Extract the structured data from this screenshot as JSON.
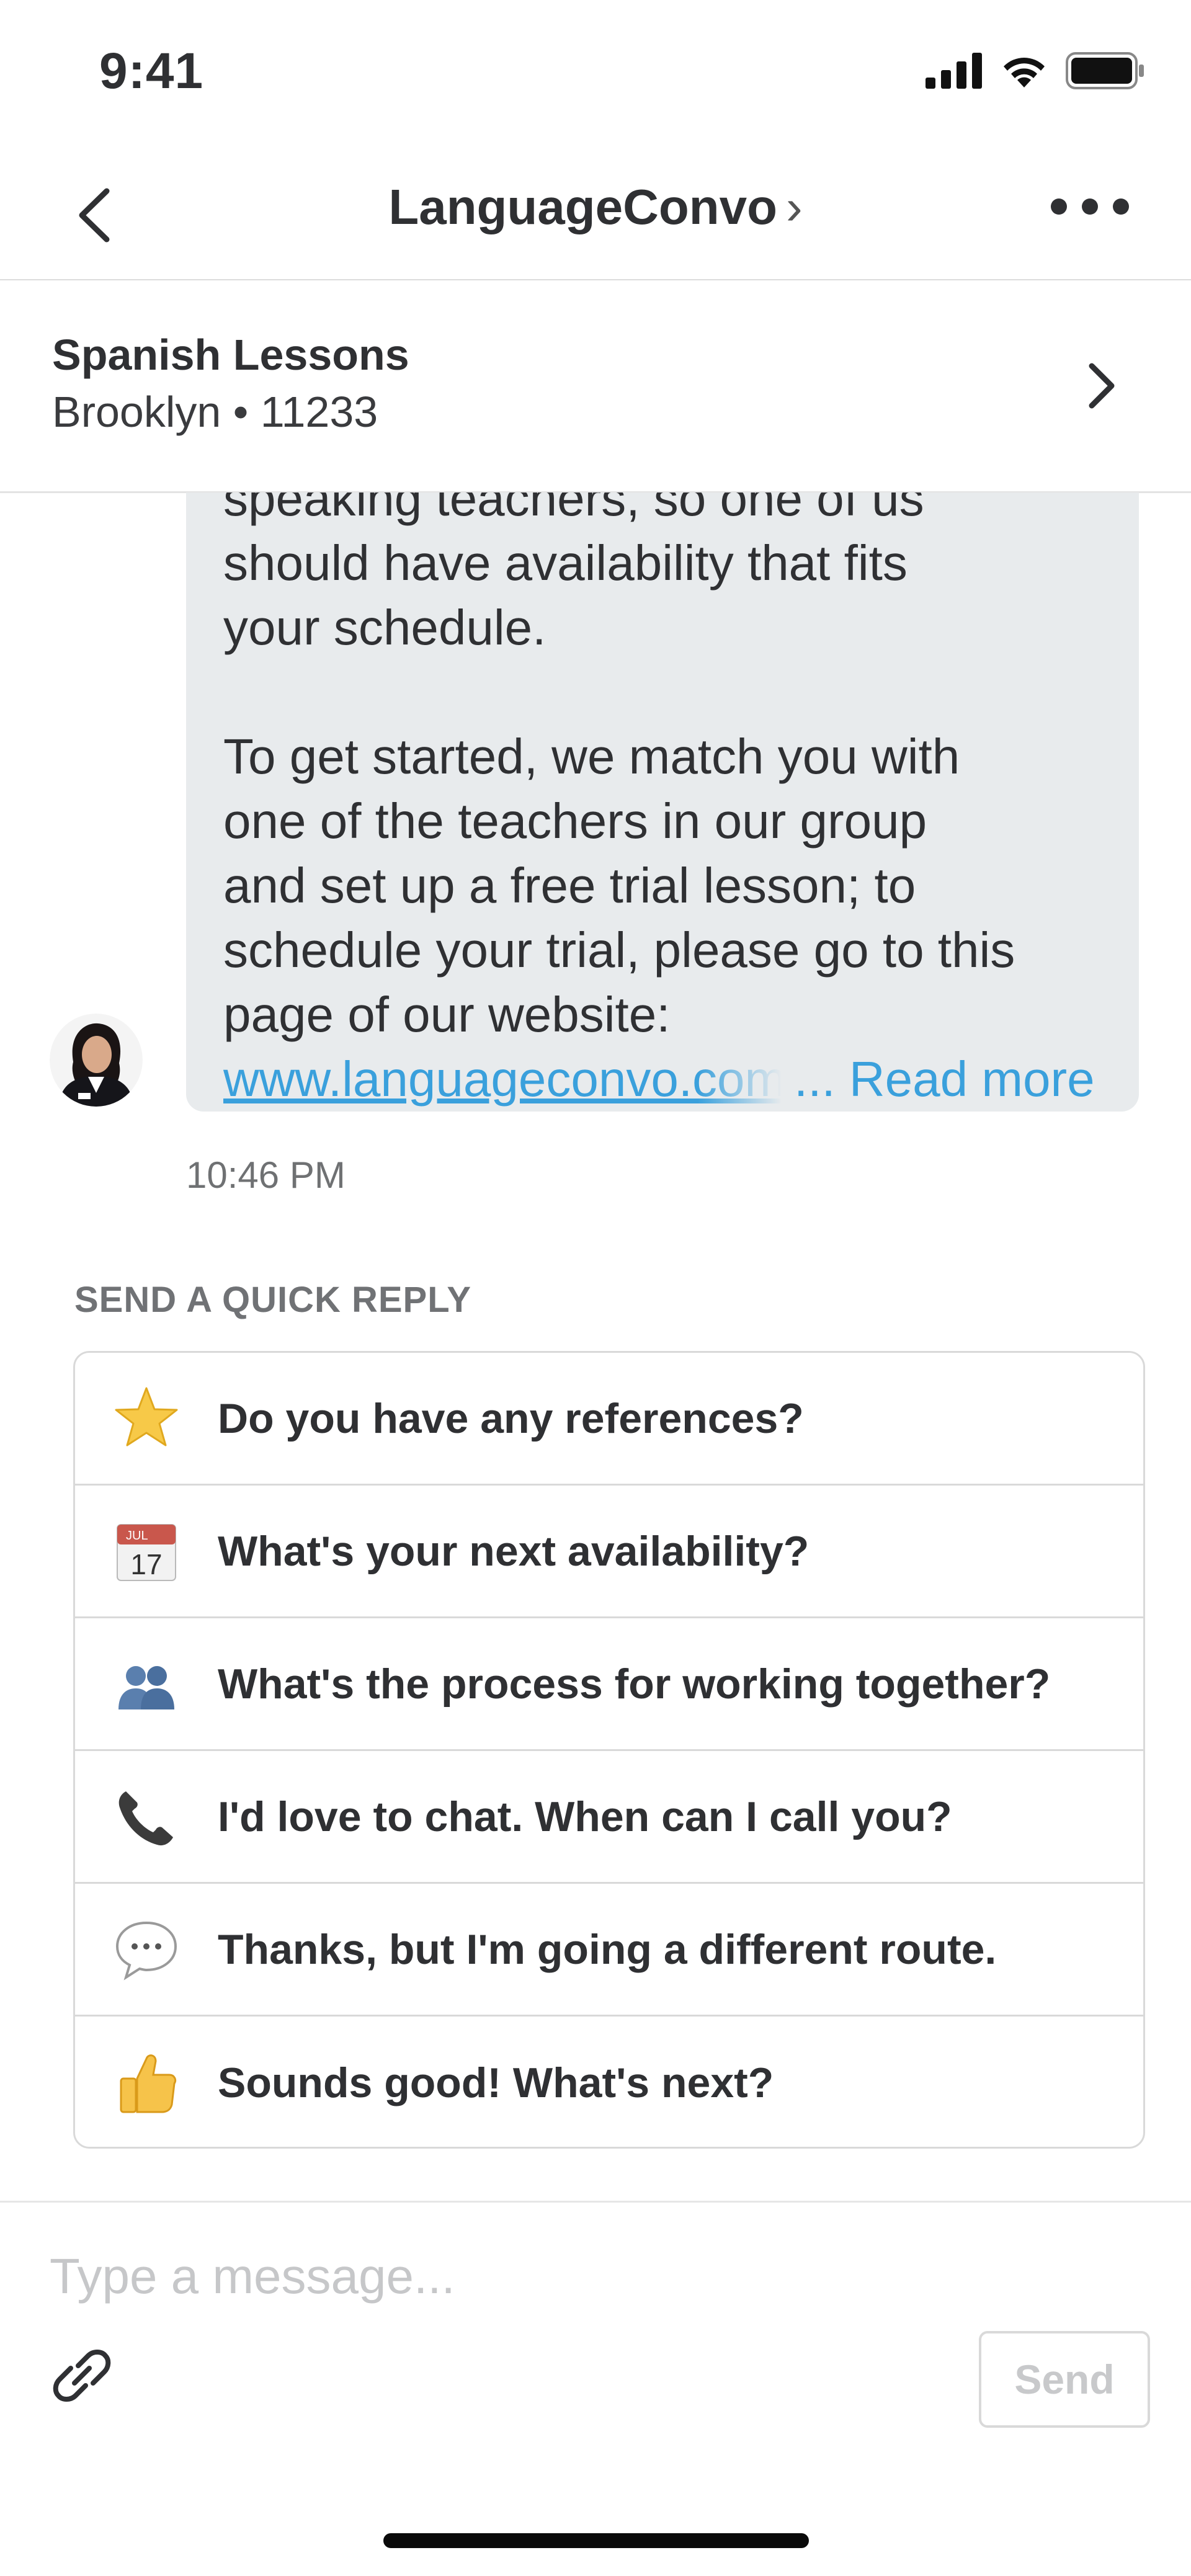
{
  "status_bar": {
    "time": "9:41"
  },
  "nav": {
    "title": "LanguageConvo",
    "title_chevron": "›"
  },
  "project": {
    "title": "Spanish Lessons",
    "subtitle": "Brooklyn • 11233"
  },
  "message": {
    "partial_top": "speaking teachers, so one of us",
    "lines1": [
      "should have availability that fits",
      "your schedule."
    ],
    "lines2": [
      "To get started, we match you with",
      "one of the teachers in our group",
      "and set up a free trial lesson; to",
      "schedule your trial, please go to this",
      "page of our website:"
    ],
    "link_text": "www.languageconvo.com",
    "read_more": "... Read more",
    "time": "10:46 PM"
  },
  "quick_reply": {
    "heading": "SEND A QUICK REPLY",
    "items": [
      {
        "icon": "star-icon",
        "label": "Do you have any references?"
      },
      {
        "icon": "calendar-icon",
        "calendar_month": "JUL",
        "calendar_day": "17",
        "label": "What's your next availability?"
      },
      {
        "icon": "people-icon",
        "label": "What's the process for working together?"
      },
      {
        "icon": "phone-icon",
        "label": "I'd love to chat. When can I call you?"
      },
      {
        "icon": "speech-bubble-icon",
        "label": "Thanks, but I'm going a different route."
      },
      {
        "icon": "thumbs-up-icon",
        "label": "Sounds good! What's next?"
      }
    ]
  },
  "composer": {
    "placeholder": "Type a message...",
    "send_label": "Send"
  },
  "colors": {
    "link": "#3aa0dc",
    "bubble": "#e8ebed",
    "divider": "#d9d9d9"
  }
}
